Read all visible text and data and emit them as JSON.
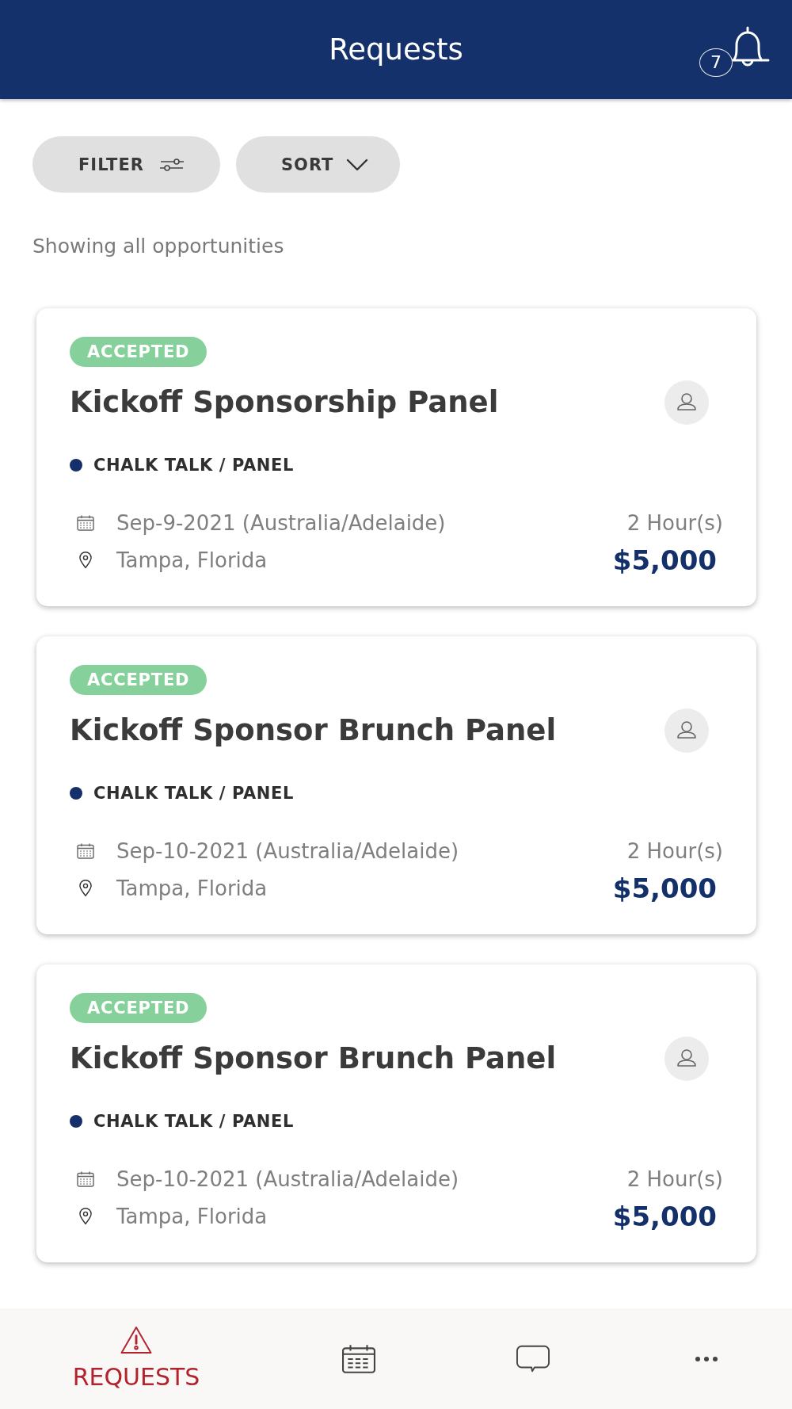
{
  "header": {
    "title": "Requests",
    "notification_count": "7"
  },
  "toolbar": [
    {
      "label": "FILTER",
      "kind": "filter"
    },
    {
      "label": "SORT",
      "kind": "sort"
    }
  ],
  "summary": "Showing all opportunities",
  "requests": [
    {
      "status": {
        "label": "ACCEPTED",
        "kind": "accepted"
      },
      "title": "Kickoff Sponsorship Panel",
      "category": {
        "label": "CHALK TALK / PANEL",
        "color": "#14306b"
      },
      "date": "Sep-9-2021 (Australia/Adelaide)",
      "location": "Tampa, Florida",
      "duration": "2 Hour(s)",
      "price": "$5,000"
    },
    {
      "status": {
        "label": "ACCEPTED",
        "kind": "accepted"
      },
      "title": "Kickoff Sponsor Brunch Panel",
      "category": {
        "label": "CHALK TALK / PANEL",
        "color": "#14306b"
      },
      "date": "Sep-10-2021 (Australia/Adelaide)",
      "location": "Tampa, Florida",
      "duration": "2 Hour(s)",
      "price": "$5,000"
    },
    {
      "status": {
        "label": "ACCEPTED",
        "kind": "accepted"
      },
      "title": "Kickoff Sponsor Brunch Panel",
      "category": {
        "label": "CHALK TALK / PANEL",
        "color": "#14306b"
      },
      "date": "Sep-10-2021 (Australia/Adelaide)",
      "location": "Tampa, Florida",
      "duration": "2 Hour(s)",
      "price": "$5,000"
    }
  ],
  "bottom_nav": [
    {
      "kind": "requests",
      "label": "REQUESTS",
      "selected": true
    },
    {
      "kind": "calendar",
      "selected": false
    },
    {
      "kind": "messages",
      "selected": false
    },
    {
      "kind": "more",
      "selected": false
    }
  ]
}
